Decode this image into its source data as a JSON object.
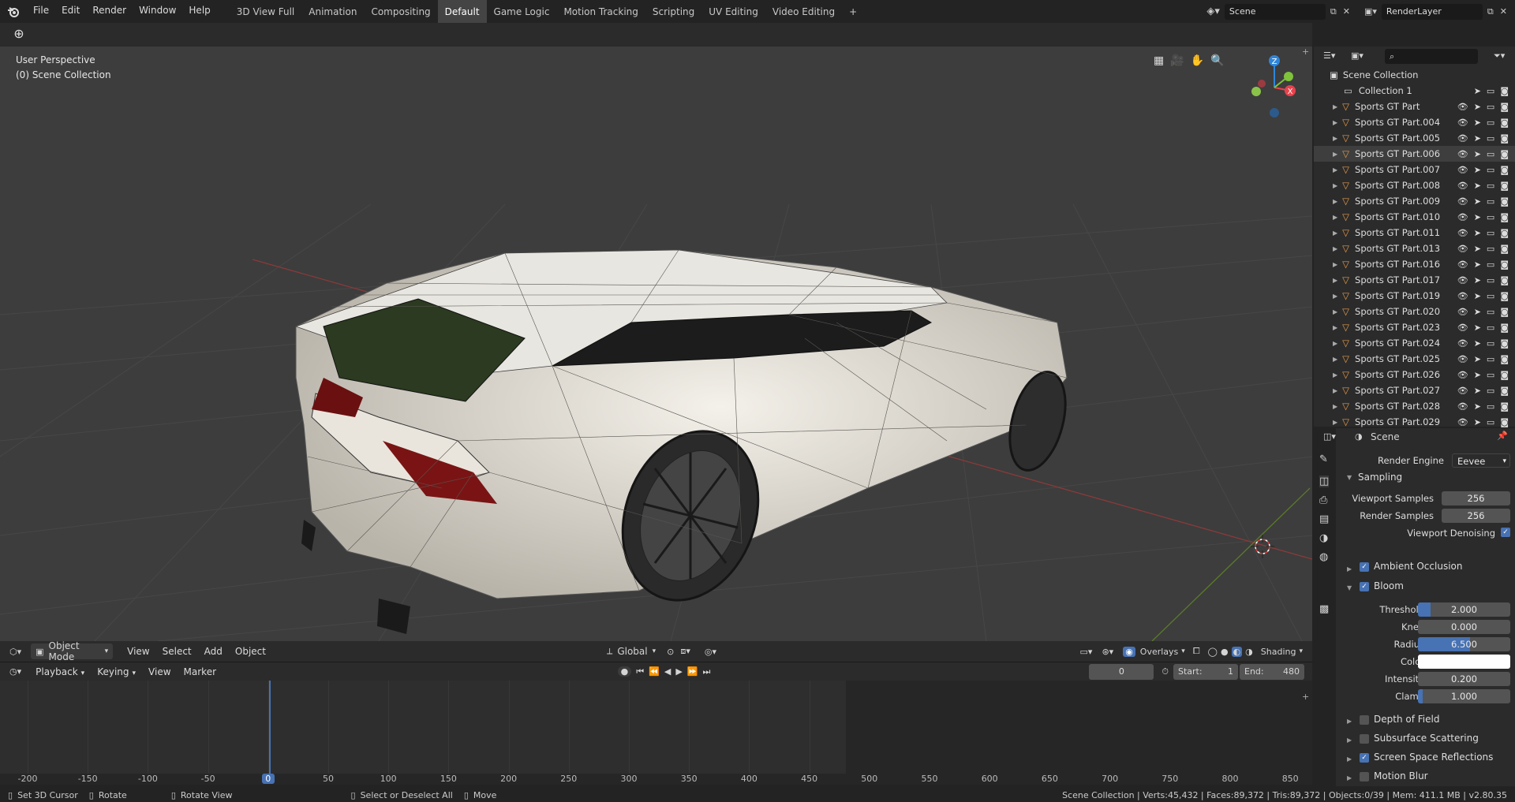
{
  "menu": {
    "items": [
      "File",
      "Edit",
      "Render",
      "Window",
      "Help"
    ]
  },
  "workspaces": {
    "tabs": [
      "3D View Full",
      "Animation",
      "Compositing",
      "Default",
      "Game Logic",
      "Motion Tracking",
      "Scripting",
      "UV Editing",
      "Video Editing"
    ],
    "active": "Default",
    "add": "+"
  },
  "scene": {
    "name": "Scene",
    "render_layer": "RenderLayer"
  },
  "viewport": {
    "view_name": "User Perspective",
    "collection_info": "(0) Scene Collection",
    "header": {
      "mode": "Object Mode",
      "view": "View",
      "select": "Select",
      "add": "Add",
      "object": "Object",
      "orientation": "Global",
      "overlays": "Overlays",
      "shading": "Shading"
    },
    "gizmo": {
      "z": "Z",
      "x": "X"
    }
  },
  "timeline": {
    "menus": [
      "Playback",
      "Keying",
      "View",
      "Marker"
    ],
    "current_frame": "0",
    "start_label": "Start:",
    "start": "1",
    "end_label": "End:",
    "end": "480",
    "ruler": [
      "-200",
      "-150",
      "-100",
      "-50",
      "0",
      "50",
      "100",
      "150",
      "200",
      "250",
      "300",
      "350",
      "400",
      "450",
      "500",
      "550",
      "600",
      "650",
      "700",
      "750",
      "800",
      "850"
    ]
  },
  "outliner": {
    "root": "Scene Collection",
    "items": [
      "Collection 1",
      "Sports GT Part",
      "Sports GT Part.004",
      "Sports GT Part.005",
      "Sports GT Part.006",
      "Sports GT Part.007",
      "Sports GT Part.008",
      "Sports GT Part.009",
      "Sports GT Part.010",
      "Sports GT Part.011",
      "Sports GT Part.013",
      "Sports GT Part.016",
      "Sports GT Part.017",
      "Sports GT Part.019",
      "Sports GT Part.020",
      "Sports GT Part.023",
      "Sports GT Part.024",
      "Sports GT Part.025",
      "Sports GT Part.026",
      "Sports GT Part.027",
      "Sports GT Part.028",
      "Sports GT Part.029"
    ]
  },
  "properties": {
    "context": "Scene",
    "render_engine_label": "Render Engine",
    "render_engine": "Eevee",
    "sampling": "Sampling",
    "viewport_samples_label": "Viewport Samples",
    "viewport_samples": "256",
    "render_samples_label": "Render Samples",
    "render_samples": "256",
    "viewport_denoising": "Viewport Denoising",
    "ambient_occlusion": "Ambient Occlusion",
    "bloom": "Bloom",
    "threshold_label": "Threshold",
    "threshold": "2.000",
    "knee_label": "Knee",
    "knee": "0.000",
    "radius_label": "Radius",
    "radius": "6.500",
    "color_label": "Color",
    "intensity_label": "Intensity",
    "intensity": "0.200",
    "clamp_label": "Clamp",
    "clamp": "1.000",
    "depth_of_field": "Depth of Field",
    "subsurface_scattering": "Subsurface Scattering",
    "screen_space_reflections": "Screen Space Reflections",
    "motion_blur": "Motion Blur"
  },
  "status": {
    "set_cursor": "Set 3D Cursor",
    "rotate": "Rotate",
    "rotate_view": "Rotate View",
    "select_all": "Select or Deselect All",
    "move": "Move",
    "stats": "Scene Collection | Verts:45,432 | Faces:89,372 | Tris:89,372 | Objects:0/39 | Mem: 411.1 MB | v2.80.35"
  },
  "colors": {
    "accent": "#4772b3",
    "object_icon": "#e59b4c",
    "axis_x": "#e8434d",
    "axis_y": "#7ec33a",
    "axis_z": "#2f86d8"
  }
}
